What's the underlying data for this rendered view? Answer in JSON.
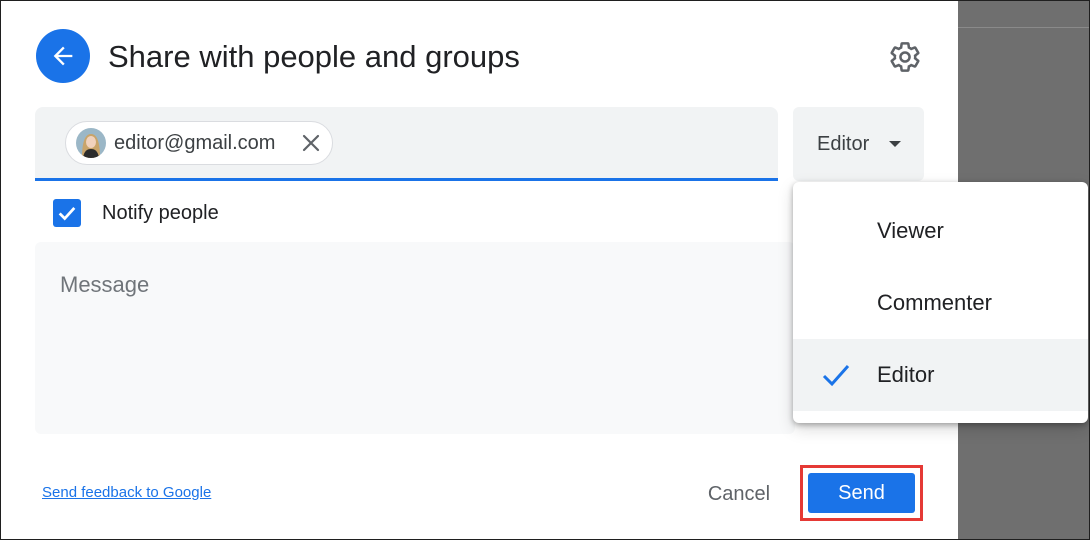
{
  "dialog": {
    "title": "Share with people and groups"
  },
  "recipients": {
    "chips": [
      {
        "email": "editor@gmail.com"
      }
    ]
  },
  "role_selector": {
    "selected_label": "Editor"
  },
  "notify": {
    "label": "Notify people",
    "checked": true
  },
  "message": {
    "placeholder": "Message"
  },
  "footer": {
    "feedback_link": "Send feedback to Google",
    "cancel_label": "Cancel",
    "send_label": "Send"
  },
  "role_menu": {
    "items": [
      {
        "label": "Viewer",
        "selected": false
      },
      {
        "label": "Commenter",
        "selected": false
      },
      {
        "label": "Editor",
        "selected": true
      }
    ]
  },
  "colors": {
    "accent": "#1a73e8",
    "highlight_box": "#e53935"
  },
  "icons": {
    "back": "arrow-left-icon",
    "settings": "gear-icon",
    "remove_chip": "close-icon",
    "dropdown": "caret-down-icon",
    "checkbox": "checkmark-icon",
    "selected_role": "check-icon"
  }
}
